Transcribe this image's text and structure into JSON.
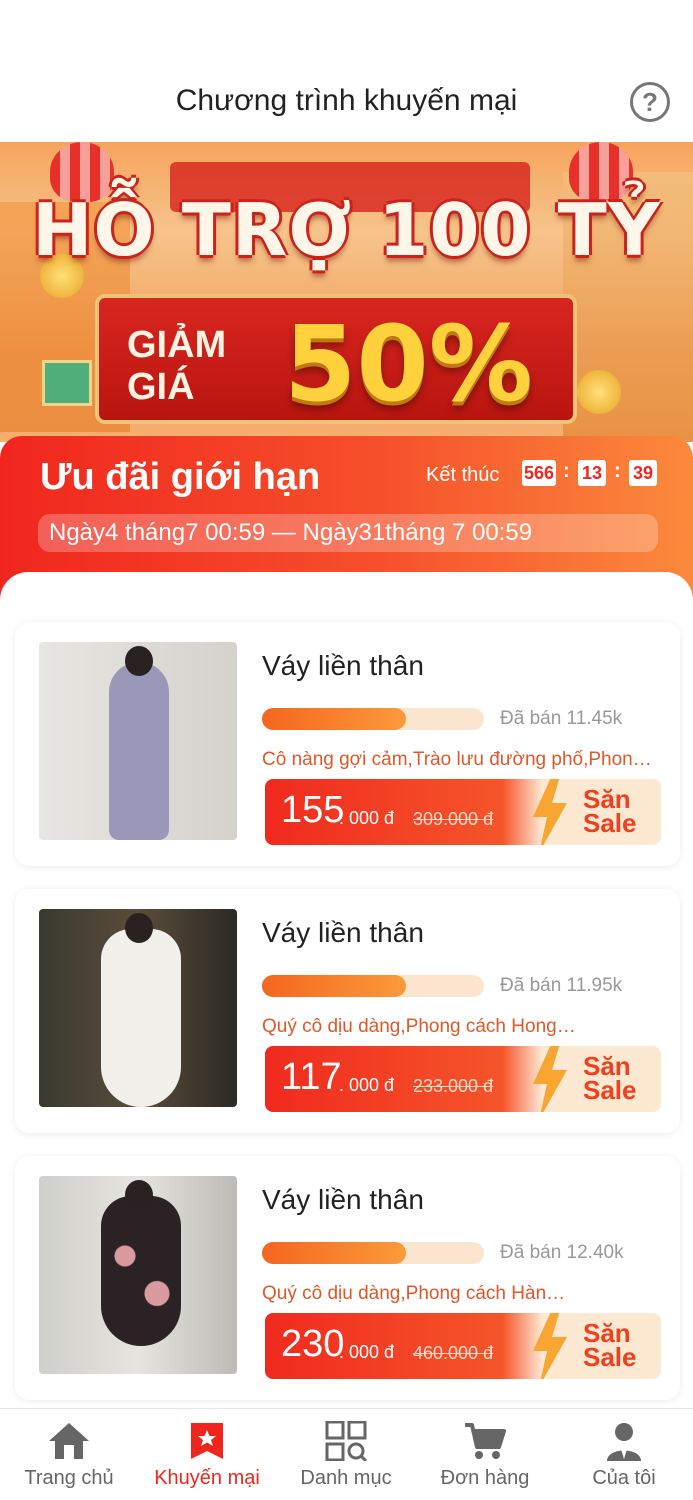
{
  "header": {
    "title": "Chương trình khuyến mại",
    "help_icon": "?"
  },
  "banner": {
    "headline": "HỖ TRỢ 100 TỶ",
    "discount_label_line1": "GIẢM",
    "discount_label_line2": "GIÁ",
    "discount_value": "50%"
  },
  "promo": {
    "title": "Ưu đãi giới hạn",
    "end_label": "Kết thúc",
    "timer": {
      "hours": "566",
      "minutes": "13",
      "seconds": "39"
    },
    "timer_separator": ":",
    "date_range": "Ngày4 tháng7 00:59 — Ngày31tháng 7 00:59"
  },
  "products": [
    {
      "title": "Váy liền thân",
      "sold_label": "Đã bán 11.45k",
      "progress": 0.65,
      "tags": "Cô nàng gợi cảm,Trào lưu đường phố,Phon…",
      "price_main": "155",
      "price_unit": ". 000 đ",
      "old_price": "309.000 đ",
      "hunt_line1": "Săn",
      "hunt_line2": "Sale"
    },
    {
      "title": "Váy liền thân",
      "sold_label": "Đã bán 11.95k",
      "progress": 0.65,
      "tags": "Quý cô dịu dàng,Phong cách Hong…",
      "price_main": "117",
      "price_unit": ". 000 đ",
      "old_price": "233.000 đ",
      "hunt_line1": "Săn",
      "hunt_line2": "Sale"
    },
    {
      "title": "Váy liền thân",
      "sold_label": "Đã bán 12.40k",
      "progress": 0.65,
      "tags": "Quý cô dịu dàng,Phong cách Hàn…",
      "price_main": "230",
      "price_unit": ". 000 đ",
      "old_price": "460.000 đ",
      "hunt_line1": "Săn",
      "hunt_line2": "Sale"
    }
  ],
  "nav": {
    "items": [
      {
        "label": "Trang chủ",
        "icon": "home-icon"
      },
      {
        "label": "Khuyến mại",
        "icon": "bookmark-star-icon",
        "active": true
      },
      {
        "label": "Danh mục",
        "icon": "category-grid-icon"
      },
      {
        "label": "Đơn hàng",
        "icon": "cart-icon"
      },
      {
        "label": "Của tôi",
        "icon": "user-icon"
      }
    ]
  },
  "colors": {
    "accent": "#f0261e",
    "orange": "#fb8a3c",
    "tag_text": "#e0582a"
  }
}
